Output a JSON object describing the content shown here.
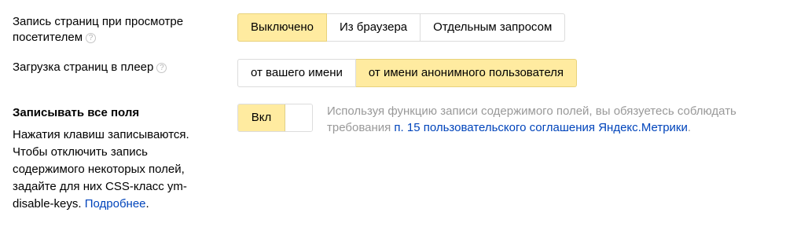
{
  "page_view_recording": {
    "label_line1": "Запись страниц при просмотре",
    "label_line2": "посетителем",
    "help_glyph": "?",
    "options": [
      "Выключено",
      "Из браузера",
      "Отдельным запросом"
    ],
    "selected": "Выключено"
  },
  "player_loading": {
    "label": "Загрузка страниц в плеер",
    "help_glyph": "?",
    "options": [
      "от вашего имени",
      "от имени анонимного пользователя"
    ],
    "selected": "от имени анонимного пользователя"
  },
  "record_all_fields": {
    "title": "Записывать все поля",
    "description_lines": [
      "Нажатия клавиш записываются.",
      "Чтобы отключить запись",
      "содержимого некоторых полей,",
      "задайте для них CSS-класс ym-",
      "disable-keys."
    ],
    "more_link": "Подробнее",
    "more_suffix": ".",
    "toggle_label": "Вкл",
    "toggle_state": "on",
    "hint_line1": "Используя функцию записи содержимого полей, вы обязуетесь соблюдать",
    "hint_prefix": "требования ",
    "hint_link": "п. 15 пользовательского соглашения Яндекс.Метрики",
    "hint_suffix": "."
  },
  "colors": {
    "active_fill": "#ffeba0",
    "link": "#0044bb",
    "hint_text": "#999999"
  }
}
